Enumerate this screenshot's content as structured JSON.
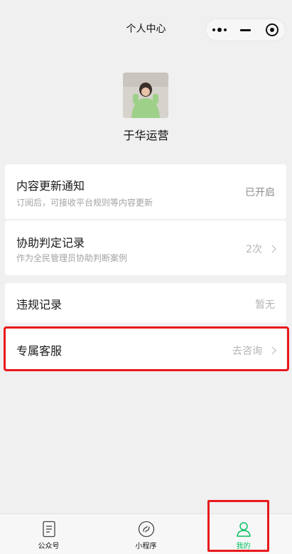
{
  "header": {
    "title": "个人中心"
  },
  "capsule": {
    "more_icon": "more-dots-icon",
    "minimize_icon": "minus-icon",
    "close_icon": "target-icon"
  },
  "profile": {
    "name": "于华运营"
  },
  "items": [
    {
      "title": "内容更新通知",
      "subtitle": "订阅后，可接收平台规则等内容更新",
      "status": "已开启"
    },
    {
      "title": "协助判定记录",
      "subtitle": "作为全民管理员协助判断案例",
      "status": "2次"
    },
    {
      "title": "违规记录",
      "status": "暂无"
    },
    {
      "title": "专属客服",
      "status": "去咨询"
    }
  ],
  "tabs": [
    {
      "label": "公众号",
      "icon": "document-icon"
    },
    {
      "label": "小程序",
      "icon": "miniprogram-icon"
    },
    {
      "label": "我的",
      "icon": "user-icon",
      "active": true
    }
  ],
  "colors": {
    "accent": "#07c160",
    "highlight": "#e8191c"
  }
}
